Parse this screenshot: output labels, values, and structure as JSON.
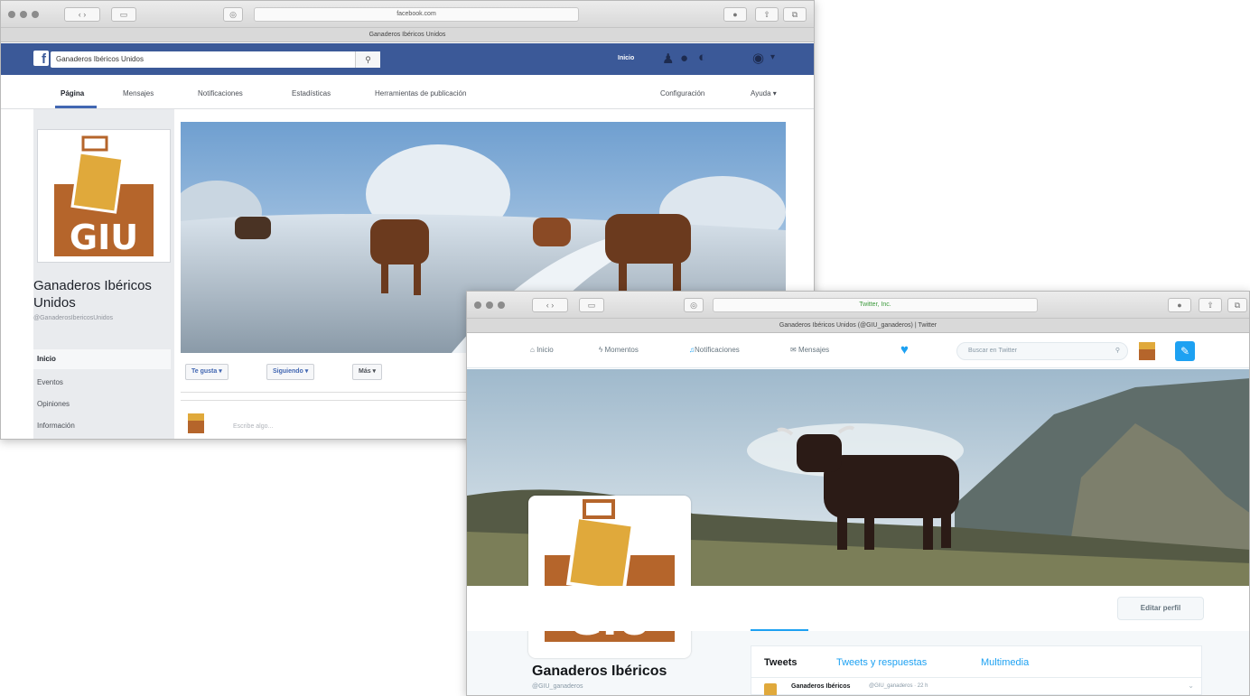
{
  "facebook": {
    "url": "facebook.com",
    "tab_title": "Ganaderos Ibéricos Unidos",
    "search_value": "Ganaderos Ibéricos Unidos",
    "user_link": "Inicio",
    "tabs": [
      "Página",
      "Mensajes",
      "Notificaciones",
      "Estadísticas",
      "Herramientas de publicación"
    ],
    "settings": "Configuración",
    "help": "Ayuda ▾",
    "page_name": "Ganaderos Ibéricos Unidos",
    "handle": "@GanaderosIbericosUnidos",
    "nav": [
      "Inicio",
      "Eventos",
      "Opiniones",
      "Información"
    ],
    "buttons": {
      "like": "Te gusta ▾",
      "follow": "Siguiendo ▾",
      "more": "Más ▾"
    },
    "composer_placeholder": "Escribe algo..."
  },
  "twitter": {
    "url": "Twitter, Inc.",
    "tab_title": "Ganaderos Ibéricos Unidos (@GIU_ganaderos) | Twitter",
    "nav": [
      "Inicio",
      "Momentos",
      "Notificaciones",
      "Mensajes"
    ],
    "search_placeholder": "Buscar en Twitter",
    "edit_profile": "Editar perfil",
    "profile_name": "Ganaderos Ibéricos",
    "handle": "@GIU_ganaderos",
    "tabs": [
      "Tweets",
      "Tweets y respuestas",
      "Multimedia"
    ],
    "tweet_author": "Ganaderos Ibéricos",
    "tweet_handle": "@GIU_ganaderos · 22 h"
  },
  "logo_text": "GIU",
  "colors": {
    "facebook_blue": "#3b5998",
    "twitter_blue": "#1da1f2",
    "logo_brown": "#b5652b",
    "logo_gold": "#e0a93b"
  }
}
